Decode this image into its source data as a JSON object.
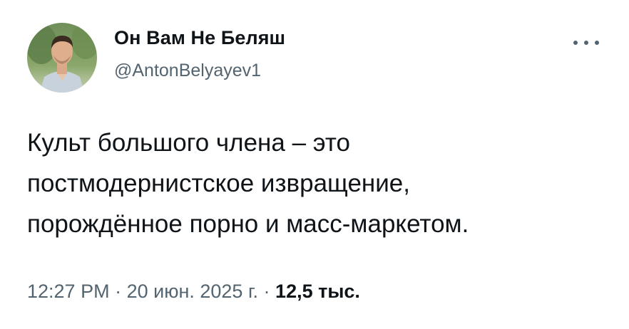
{
  "author": {
    "display_name": "Он Вам Не Беляш",
    "handle": "@AntonBelyayev1",
    "avatar_icon": "profile-photo"
  },
  "menu": {
    "icon": "more-horizontal-icon"
  },
  "tweet": {
    "lines": [
      "Культ большого члена – это",
      "постмодернистское извращение,",
      "порождённое порно и масс-маркетом."
    ]
  },
  "meta": {
    "time": "12:27 PM",
    "separator": "·",
    "date": "20 июн. 2025 г.",
    "views_count": "12,5",
    "views_unit": "тыс."
  },
  "colors": {
    "text_primary": "#0f1419",
    "text_secondary": "#536471",
    "background": "#ffffff"
  }
}
